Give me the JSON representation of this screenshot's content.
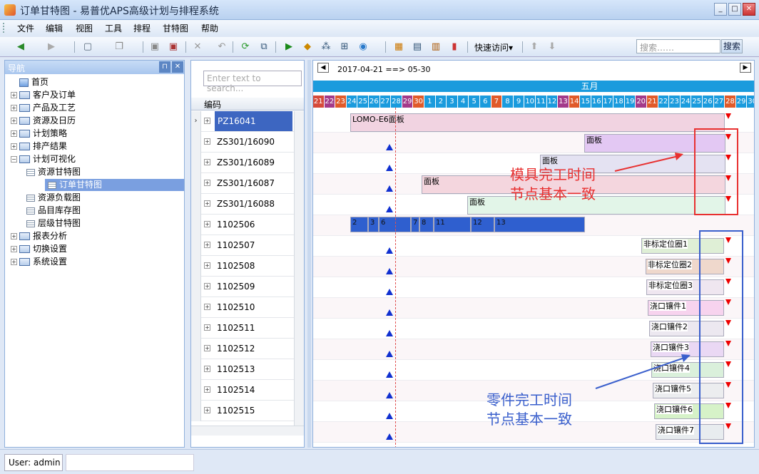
{
  "window": {
    "title": "订单甘特图 - 易普优APS高级计划与排程系统"
  },
  "menu": [
    "文件",
    "编辑",
    "视图",
    "工具",
    "排程",
    "甘特图",
    "帮助"
  ],
  "toolbar": {
    "quick_access": "快速访问▾",
    "search_placeholder": "搜索……",
    "search_button": "搜索"
  },
  "nav": {
    "title": "导航",
    "items": [
      {
        "label": "首页",
        "level": 0,
        "type": "home"
      },
      {
        "label": "客户及订单",
        "level": 0,
        "type": "folder"
      },
      {
        "label": "产品及工艺",
        "level": 0,
        "type": "folder"
      },
      {
        "label": "资源及日历",
        "level": 0,
        "type": "folder"
      },
      {
        "label": "计划策略",
        "level": 0,
        "type": "folder"
      },
      {
        "label": "排产结果",
        "level": 0,
        "type": "folder"
      },
      {
        "label": "计划可视化",
        "level": 0,
        "type": "folder-open"
      },
      {
        "label": "资源甘特图",
        "level": 1,
        "type": "leaf"
      },
      {
        "label": "订单甘特图",
        "level": 1,
        "type": "leaf",
        "selected": true
      },
      {
        "label": "资源负载图",
        "level": 1,
        "type": "leaf"
      },
      {
        "label": "品目库存图",
        "level": 1,
        "type": "leaf"
      },
      {
        "label": "层级甘特图",
        "level": 1,
        "type": "leaf"
      },
      {
        "label": "报表分析",
        "level": 0,
        "type": "folder"
      },
      {
        "label": "切换设置",
        "level": 0,
        "type": "folder"
      },
      {
        "label": "系统设置",
        "level": 0,
        "type": "folder"
      }
    ]
  },
  "grid": {
    "search_placeholder": "Enter text to search...",
    "column_header": "编码",
    "rows": [
      "PZ16041",
      "ZS301/16090",
      "ZS301/16089",
      "ZS301/16087",
      "ZS301/16088",
      "1102506",
      "1102507",
      "1102508",
      "1102509",
      "1102510",
      "1102511",
      "1102512",
      "1102513",
      "1102514",
      "1102515"
    ]
  },
  "gantt": {
    "range": "2017-04-21 ==> 05-30",
    "month_label": "五月",
    "days": [
      "21",
      "22",
      "23",
      "24",
      "25",
      "26",
      "27",
      "28",
      "29",
      "30",
      "1",
      "2",
      "3",
      "4",
      "5",
      "6",
      "7",
      "8",
      "9",
      "10",
      "11",
      "12",
      "13",
      "14",
      "15",
      "16",
      "17",
      "18",
      "19",
      "20",
      "21",
      "22",
      "23",
      "24",
      "25",
      "26",
      "27",
      "28",
      "29",
      "30"
    ],
    "bars": [
      {
        "row": 0,
        "label": "LOMO-E6面板"
      },
      {
        "row": 1,
        "label": "面板"
      },
      {
        "row": 2,
        "label": "面板"
      },
      {
        "row": 3,
        "label": "面板"
      },
      {
        "row": 4,
        "label": "面板"
      },
      {
        "row": 5,
        "segments": [
          "2",
          "3",
          "6",
          "7",
          "8",
          "11",
          "12",
          "13"
        ]
      },
      {
        "row": 6,
        "label": "非标定位圈1"
      },
      {
        "row": 7,
        "label": "非标定位圈2"
      },
      {
        "row": 8,
        "label": "非标定位圈3"
      },
      {
        "row": 9,
        "label": "浇口镶件1"
      },
      {
        "row": 10,
        "label": "浇口镶件2"
      },
      {
        "row": 11,
        "label": "浇口镶件3"
      },
      {
        "row": 12,
        "label": "浇口镶件4"
      },
      {
        "row": 13,
        "label": "浇口镶件5"
      },
      {
        "row": 14,
        "label": "浇口镶件6"
      },
      {
        "row": 15,
        "label": "浇口镶件7"
      }
    ]
  },
  "annotations": {
    "mold_line1": "模具完工时间",
    "mold_line2": "节点基本一致",
    "part_line1": "零件完工时间",
    "part_line2": "节点基本一致"
  },
  "status": {
    "user": "User: admin"
  },
  "colors": {
    "accent": "#1a9bdd",
    "selection": "#3d66c1",
    "red_box": "#e83030",
    "blue_box": "#3a5fcc"
  }
}
